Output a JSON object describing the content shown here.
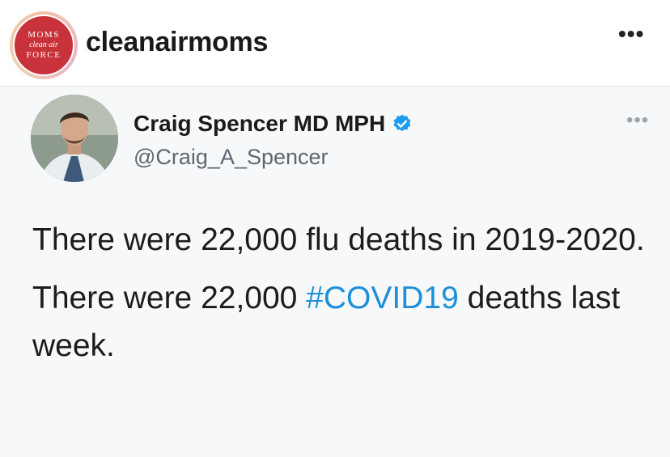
{
  "instagram": {
    "avatar": {
      "line1": "MOMS",
      "line2": "clean air",
      "line3": "FORCE",
      "color": "#c8333b"
    },
    "username": "cleanairmoms",
    "more_icon": "more-horizontal-icon"
  },
  "tweet": {
    "author_name": "Craig Spencer MD MPH",
    "verified_icon": "verified-badge-icon",
    "handle": "@Craig_A_Spencer",
    "more_icon": "more-horizontal-icon",
    "paragraph1": "There were 22,000 flu deaths in 2019-2020.",
    "paragraph2_before": "There were 22,000 ",
    "paragraph2_hashtag": "#COVID19",
    "paragraph2_after": " deaths last week.",
    "hashtag_color": "#1d8fd8",
    "verified_color": "#1d9bf0"
  }
}
